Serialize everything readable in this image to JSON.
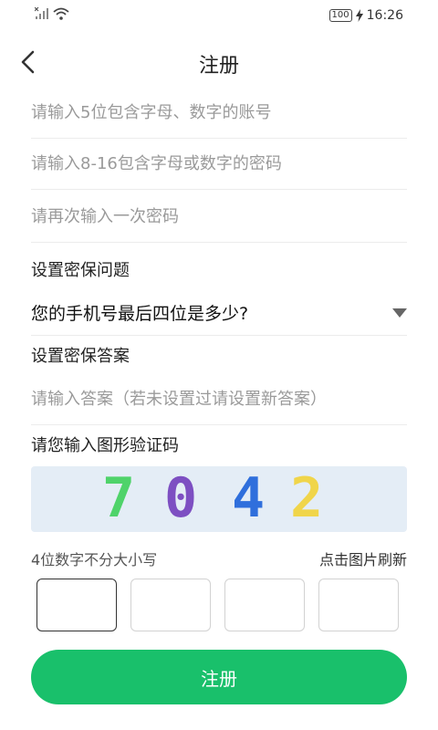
{
  "status_bar": {
    "time": "16:26",
    "battery_text": "100",
    "signal_icon": "signal-icon",
    "wifi_icon": "wifi-icon",
    "charging_icon": "bolt-icon"
  },
  "header": {
    "title": "注册",
    "back_icon": "chevron-left-icon"
  },
  "form": {
    "account_placeholder": "请输入5位包含字母、数字的账号",
    "password_placeholder": "请输入8-16包含字母或数字的密码",
    "confirm_placeholder": "请再次输入一次密码",
    "question_label": "设置密保问题",
    "question_value": "您的手机号最后四位是多少?",
    "answer_label": "设置密保答案",
    "answer_placeholder": "请输入答案（若未设置过请设置新答案）",
    "captcha_label": "请您输入图形验证码",
    "captcha_digits": [
      {
        "char": "7",
        "color": "#4fd36a"
      },
      {
        "char": "0",
        "color": "#7d4fc2"
      },
      {
        "char": "4",
        "color": "#2f6fdc"
      },
      {
        "char": "2",
        "color": "#f0d54a"
      }
    ],
    "captcha_hint": "4位数字不分大小写",
    "refresh_hint": "点击图片刷新",
    "submit_label": "注册"
  },
  "colors": {
    "accent": "#19c06b",
    "captcha_bg": "#e4edf6"
  }
}
